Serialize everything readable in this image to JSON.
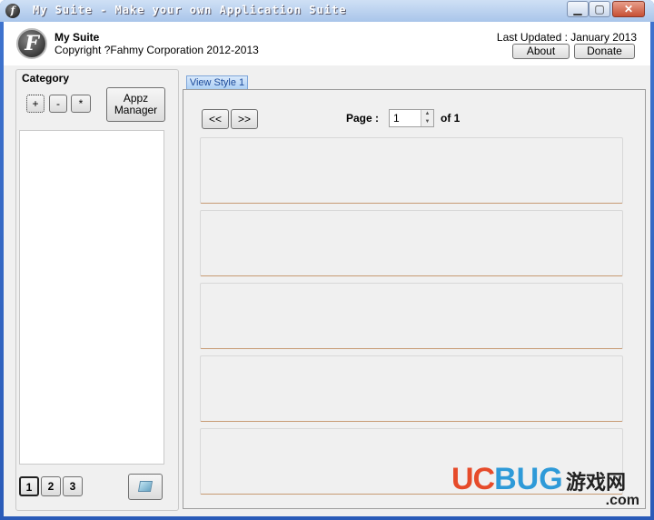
{
  "window": {
    "title": "My Suite - Make your own Application Suite",
    "icon_letter": "f",
    "controls": [
      "minimize-icon",
      "maximize-icon",
      "close-icon"
    ]
  },
  "header": {
    "logo_letter": "F",
    "app_name": "My Suite",
    "copyright": "Copyright ?Fahmy Corporation 2012-2013",
    "last_updated": "Last Updated : January 2013",
    "about_label": "About",
    "donate_label": "Donate"
  },
  "category": {
    "label": "Category",
    "add_label": "+",
    "remove_label": "-",
    "star_label": "*",
    "appz_manager_label": "Appz\nManager",
    "pages": [
      "1",
      "2",
      "3"
    ]
  },
  "view": {
    "tab_label": "View Style 1",
    "prev_label": "<<",
    "next_label": ">>",
    "page_label": "Page :",
    "page_value": "1",
    "of_label": "of 1"
  },
  "watermark": {
    "uc": "UC",
    "bug": "BUG",
    "cn": "游戏网",
    "com": ".com"
  },
  "colors": {
    "titlebar": "#a9c5ea",
    "accent_blue": "#1b4a9a",
    "item_border": "#c79a73"
  }
}
